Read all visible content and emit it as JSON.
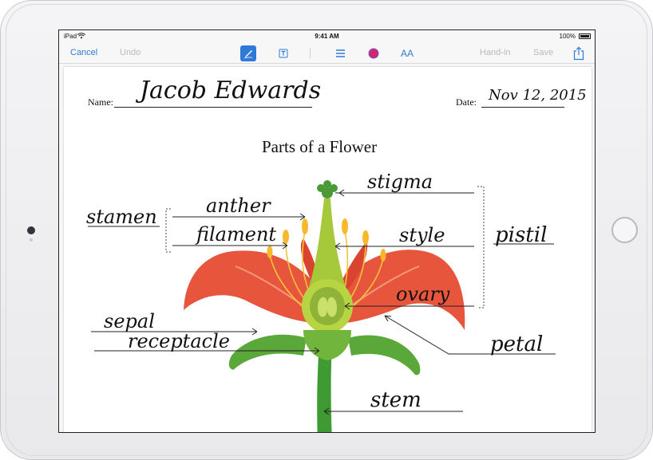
{
  "status_bar": {
    "carrier": "iPad",
    "time": "9:41 AM",
    "battery": "100%"
  },
  "toolbar": {
    "cancel": "Cancel",
    "undo": "Undo",
    "hand_in": "Hand-in",
    "save": "Save",
    "font_size_label": "AA"
  },
  "colors": {
    "accent": "#2f7ad9",
    "disabled": "#b9b9b9",
    "ink_color": "#d6266b"
  },
  "worksheet": {
    "name_label": "Name:",
    "name_value": "Jacob Edwards",
    "date_label": "Date:",
    "date_value": "Nov 12, 2015",
    "title": "Parts of a Flower",
    "labels": {
      "stigma": "stigma",
      "anther": "anther",
      "stamen": "stamen",
      "filament": "filament",
      "style": "style",
      "pistil": "pistil",
      "ovary": "ovary",
      "sepal": "sepal",
      "receptacle": "receptacle",
      "petal": "petal",
      "stem": "stem"
    }
  }
}
